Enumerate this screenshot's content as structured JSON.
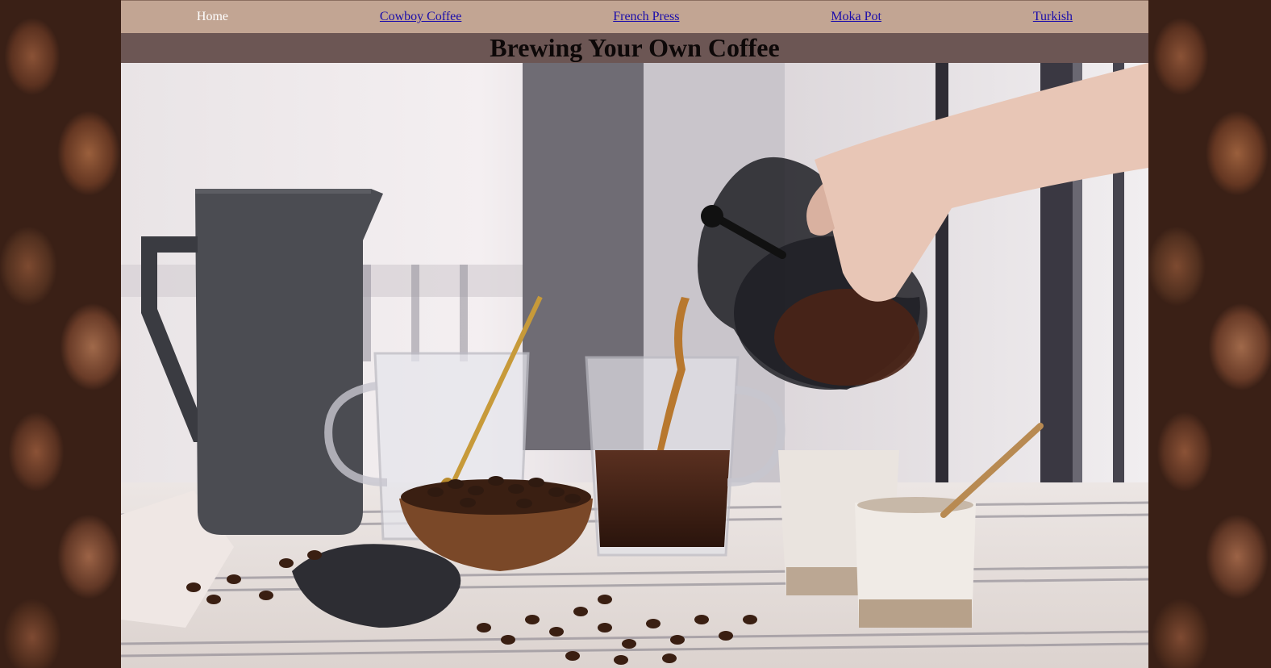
{
  "nav": {
    "items": [
      {
        "label": "Home",
        "active": true
      },
      {
        "label": "Cowboy Coffee",
        "active": false
      },
      {
        "label": "French Press",
        "active": false
      },
      {
        "label": "Moka Pot",
        "active": false
      },
      {
        "label": "Turkish",
        "active": false
      }
    ]
  },
  "header": {
    "title": "Brewing Your Own Coffee"
  },
  "colors": {
    "nav_bg": "#c2a593",
    "header_bg": "#6c5654",
    "link": "#1a0dab",
    "active_link": "#ffffff"
  },
  "hero": {
    "icon": "coffee-pour-photo"
  }
}
